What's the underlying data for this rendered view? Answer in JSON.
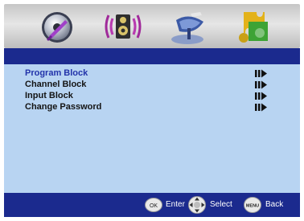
{
  "tabs": [
    {
      "icon": "picture-disc-icon"
    },
    {
      "icon": "audio-speaker-icon"
    },
    {
      "icon": "satellite-dish-icon"
    },
    {
      "icon": "puzzle-settings-icon"
    }
  ],
  "menu": {
    "items": [
      {
        "label": "Program Block",
        "selected": true
      },
      {
        "label": "Channel Block",
        "selected": false
      },
      {
        "label": "Input Block",
        "selected": false
      },
      {
        "label": "Change Password",
        "selected": false
      }
    ]
  },
  "footer": {
    "ok_button": "OK",
    "enter_label": "Enter",
    "select_label": "Select",
    "menu_button": "MENU",
    "back_label": "Back"
  },
  "colors": {
    "header_band": "#1b2a8e",
    "panel": "#b8d4f2",
    "selected_text": "#2233aa"
  }
}
